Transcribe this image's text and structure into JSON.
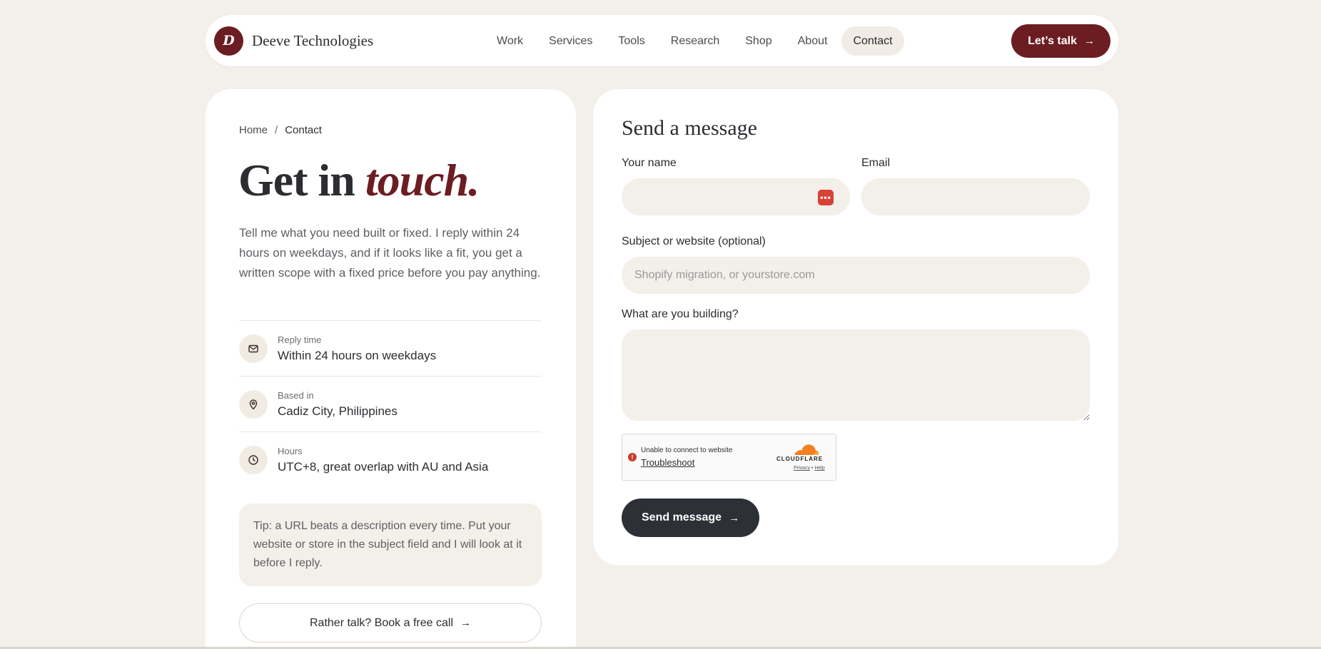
{
  "brand": {
    "logo_letter": "D",
    "name": "Deeve Technologies"
  },
  "nav": {
    "links": [
      "Work",
      "Services",
      "Tools",
      "Research",
      "Shop",
      "About",
      "Contact"
    ],
    "active": "Contact",
    "cta_label": "Let’s talk"
  },
  "breadcrumb": {
    "home": "Home",
    "sep": "/",
    "current": "Contact"
  },
  "hero": {
    "title_plain": "Get in ",
    "title_accent": "touch."
  },
  "intro": "Tell me what you need built or fixed. I reply within 24 hours on weekdays, and if it looks like a fit, you get a written scope with a fixed price before you pay anything.",
  "info": [
    {
      "icon": "mail-icon",
      "label": "Reply time",
      "value": "Within 24 hours on weekdays"
    },
    {
      "icon": "location-pin-icon",
      "label": "Based in",
      "value": "Cadiz City, Philippines"
    },
    {
      "icon": "clock-icon",
      "label": "Hours",
      "value": "UTC+8, great overlap with AU and Asia"
    }
  ],
  "tip": "Tip: a URL beats a description every time. Put your website or store in the subject field and I will look at it before I reply.",
  "book_call_label": "Rather talk? Book a free call",
  "form": {
    "title": "Send a message",
    "name_label": "Your name",
    "name_value": "",
    "email_label": "Email",
    "email_value": "",
    "subject_label": "Subject or website (optional)",
    "subject_placeholder": "Shopify migration, or yourstore.com",
    "message_label": "What are you building?",
    "message_value": "",
    "send_label": "Send message"
  },
  "captcha": {
    "error_text": "Unable to connect to website",
    "link_text": "Troubleshoot",
    "brand": "CLOUDFLARE",
    "privacy": "Privacy",
    "dot": "•",
    "help": "Help"
  },
  "colors": {
    "accent": "#6b1d22",
    "dark_button": "#2d3036",
    "background": "#f3f0eb",
    "field_bg": "#f3efe9"
  }
}
